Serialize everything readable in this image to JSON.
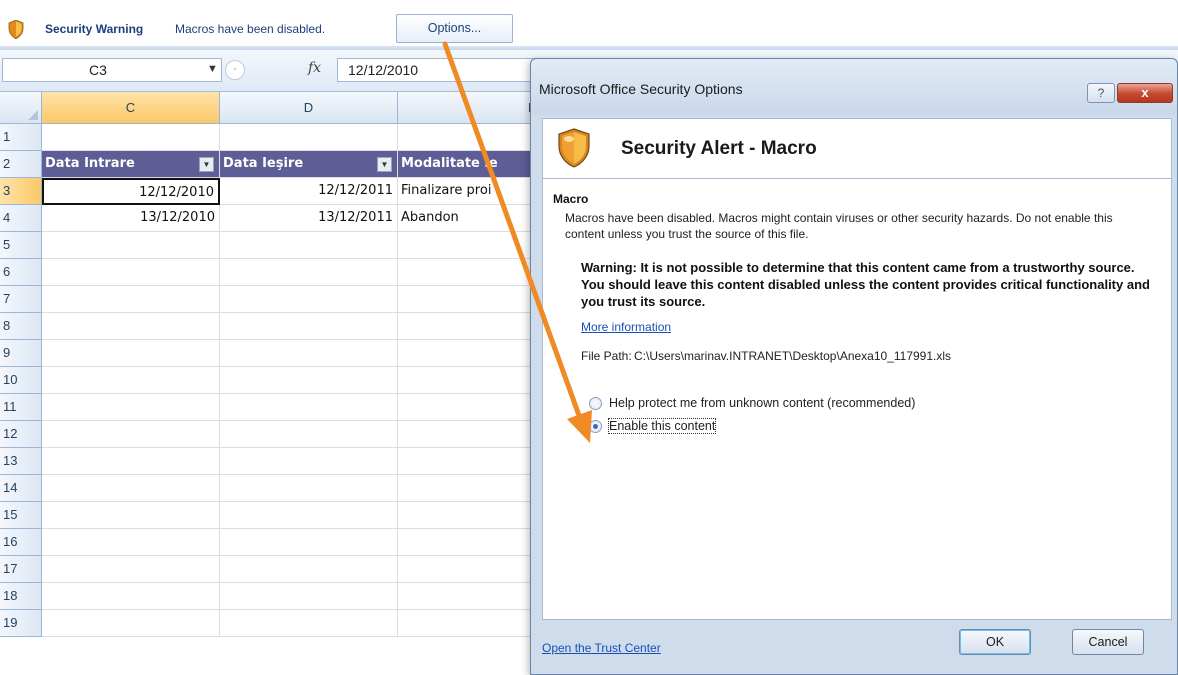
{
  "message_bar": {
    "title": "Security Warning",
    "text": "Macros have been disabled.",
    "options_button": "Options..."
  },
  "formula_bar": {
    "name_box": "C3",
    "fx_symbol": "fx",
    "value": "12/12/2010"
  },
  "sheet": {
    "columns": [
      "C",
      "D",
      "E"
    ],
    "selected_column": "C",
    "rows": [
      "1",
      "2",
      "3",
      "4",
      "5",
      "6",
      "7",
      "8",
      "9",
      "10",
      "11",
      "12",
      "13",
      "14",
      "15",
      "16",
      "17",
      "18",
      "19"
    ],
    "selected_row": "3",
    "headers": [
      "Data Intrare",
      "Data Ieşire",
      "Modalitate le"
    ],
    "data": [
      [
        "12/12/2010",
        "12/12/2011",
        "Finalizare proi"
      ],
      [
        "13/12/2010",
        "13/12/2011",
        "Abandon"
      ]
    ]
  },
  "dialog": {
    "title": "Microsoft Office Security Options",
    "help_button": "?",
    "close_button": "x",
    "heading": "Security Alert - Macro",
    "section_label": "Macro",
    "description": "Macros have been disabled. Macros might contain viruses or other security hazards. Do not enable this content unless you trust the source of this file.",
    "warning": "Warning: It is not possible to determine that this content came from a trustworthy source. You should leave this content disabled unless the content provides critical functionality and you trust its source.",
    "more_info": "More information",
    "file_path_label": "File Path:",
    "file_path": "C:\\Users\\marinav.INTRANET\\Desktop\\Anexa10_117991.xls",
    "options": [
      {
        "label": "Help protect me from unknown content (recommended)",
        "selected": false
      },
      {
        "label": "Enable this content",
        "selected": true
      }
    ],
    "trust_center_link": "Open the Trust Center",
    "ok_button": "OK",
    "cancel_button": "Cancel"
  },
  "colors": {
    "table_header": "#5f5d96",
    "selection": "#fbc868",
    "arrow": "#f08a24",
    "link": "#1750b5"
  }
}
